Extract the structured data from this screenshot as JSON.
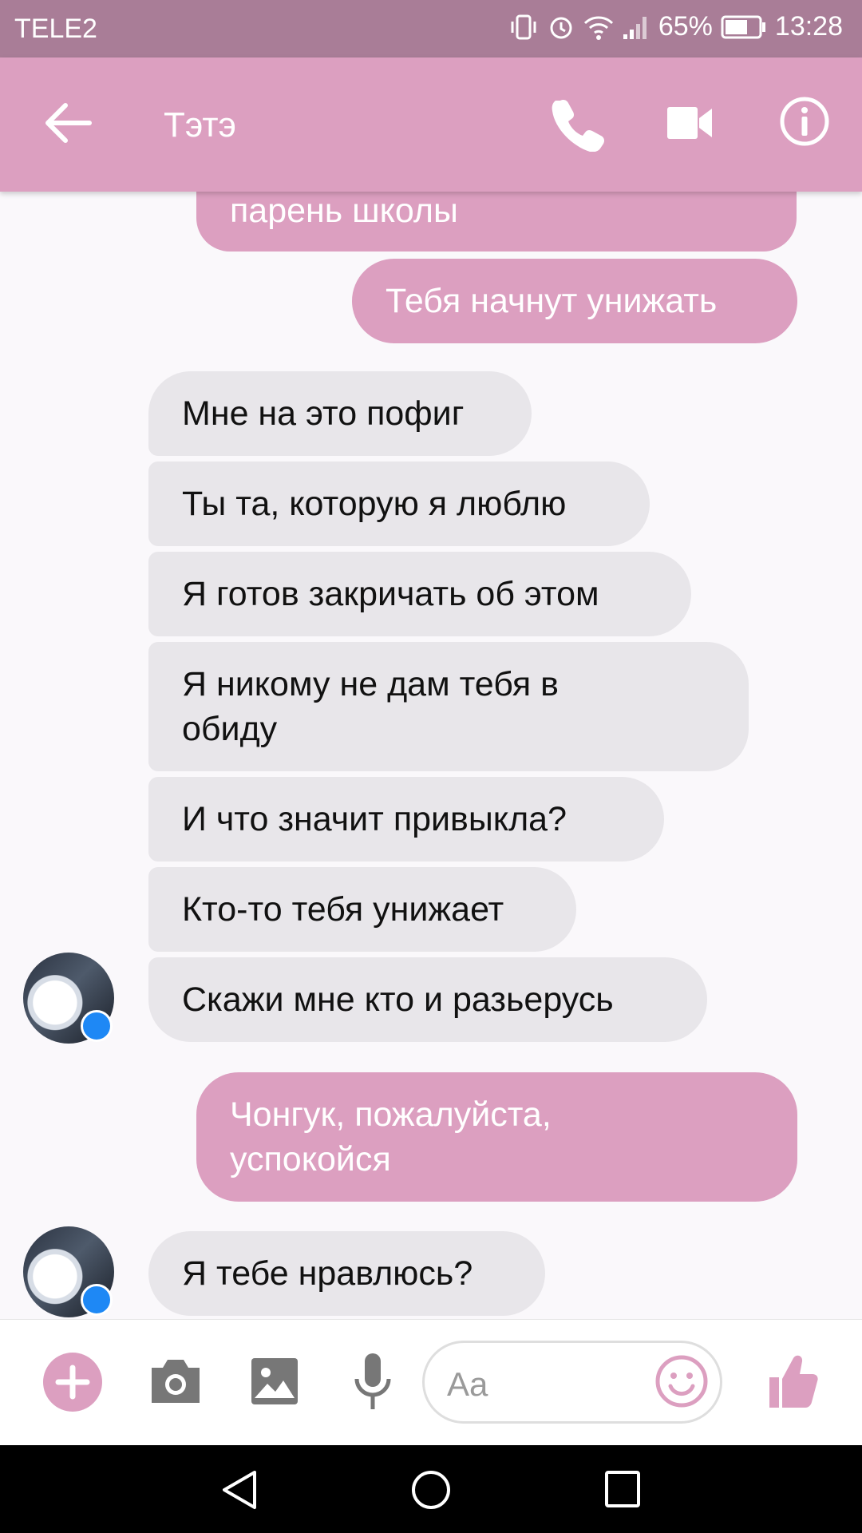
{
  "status_bar": {
    "carrier": "TELE2",
    "battery": "65%",
    "time": "13:28"
  },
  "header": {
    "contact_name": "Тэтэ",
    "icons": [
      "back-arrow-icon",
      "phone-icon",
      "video-icon",
      "info-icon"
    ]
  },
  "messages": [
    {
      "direction": "outgoing",
      "text": "парень школы"
    },
    {
      "direction": "outgoing",
      "text": "Тебя начнут унижать"
    },
    {
      "direction": "incoming",
      "text": "Мне на это пофиг"
    },
    {
      "direction": "incoming",
      "text": "Ты та, которую я люблю"
    },
    {
      "direction": "incoming",
      "text": "Я готов закричать об этом"
    },
    {
      "direction": "incoming",
      "text": "Я никому не дам тебя в обиду"
    },
    {
      "direction": "incoming",
      "text": "И что значит привыкла?"
    },
    {
      "direction": "incoming",
      "text": "Кто-то тебя унижает"
    },
    {
      "direction": "incoming",
      "text": "Скажи мне кто и разьерусь"
    },
    {
      "direction": "outgoing",
      "text": "Чонгук, пожалуйста, успокойся"
    },
    {
      "direction": "incoming",
      "text": "Я тебе нравлюсь?"
    }
  ],
  "composer": {
    "placeholder": "Aa",
    "icons": [
      "plus-icon",
      "camera-icon",
      "gallery-icon",
      "microphone-icon",
      "emoji-icon",
      "thumbs-up-icon"
    ]
  },
  "colors": {
    "accent": "#dc9fc0",
    "status_bar": "#a97d97",
    "incoming_bubble": "#e8e6ea"
  }
}
